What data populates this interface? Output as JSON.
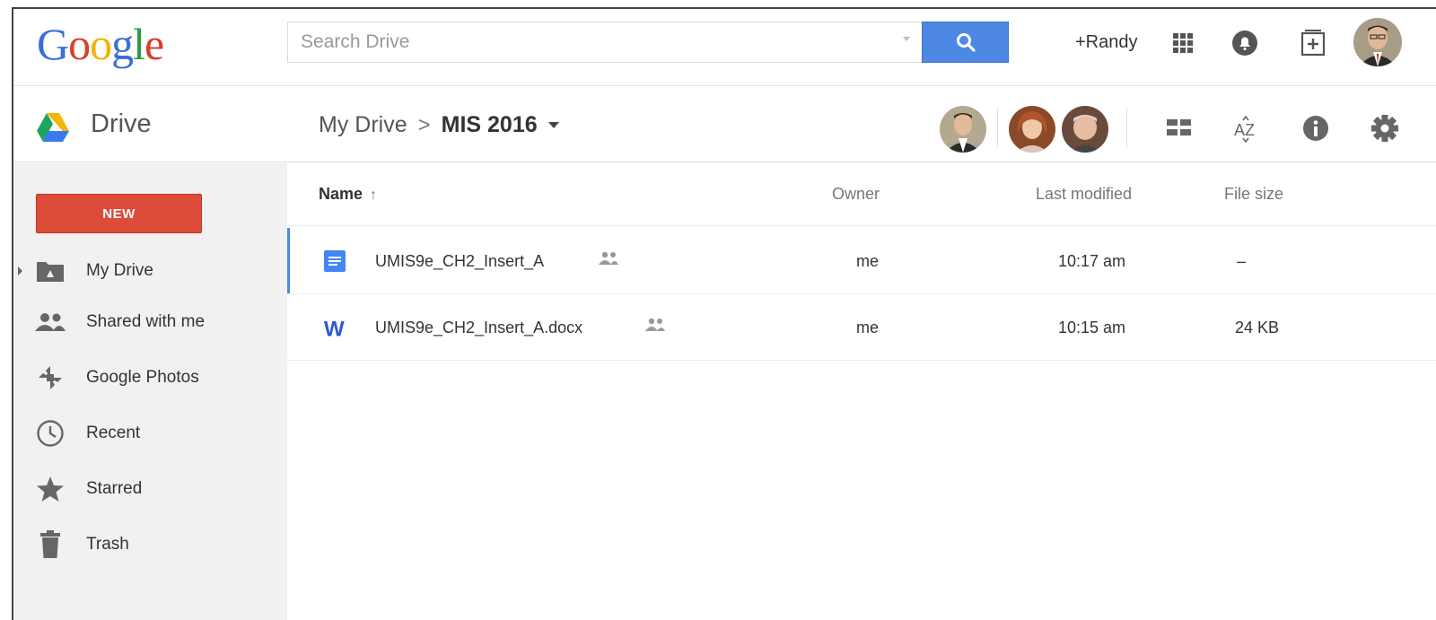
{
  "google_logo": {
    "letters": [
      "G",
      "o",
      "o",
      "g",
      "l",
      "e"
    ],
    "colors": [
      "#3b6ed8",
      "#d6402c",
      "#f0b400",
      "#3b6ed8",
      "#2e9a48",
      "#d6402c"
    ]
  },
  "search": {
    "placeholder": "Search Drive",
    "value": ""
  },
  "header": {
    "user_link": "+Randy",
    "icons": [
      "apps-grid-icon",
      "notifications-icon",
      "share-add-icon"
    ]
  },
  "subbar": {
    "app_name": "Drive",
    "breadcrumb": {
      "root": "My Drive",
      "separator": ">",
      "current": "MIS 2016"
    },
    "icons": [
      "grid-view-icon",
      "sort-az-icon",
      "info-icon",
      "settings-icon"
    ]
  },
  "sidebar": {
    "new_label": "NEW",
    "items": [
      {
        "label": "My Drive",
        "icon": "drive-folder-icon"
      },
      {
        "label": "Shared with me",
        "icon": "people-icon"
      },
      {
        "label": "Google Photos",
        "icon": "photos-pinwheel-icon"
      },
      {
        "label": "Recent",
        "icon": "clock-icon"
      },
      {
        "label": "Starred",
        "icon": "star-icon"
      },
      {
        "label": "Trash",
        "icon": "trash-icon"
      }
    ]
  },
  "list": {
    "columns": {
      "name": "Name",
      "sort_arrow": "↑",
      "owner": "Owner",
      "modified": "Last modified",
      "size": "File size"
    },
    "rows": [
      {
        "name": "UMIS9e_CH2_Insert_A",
        "type": "google-doc",
        "owner": "me",
        "modified": "10:17 am",
        "size": "–"
      },
      {
        "name": "UMIS9e_CH2_Insert_A.docx",
        "type": "word-doc",
        "owner": "me",
        "modified": "10:15 am",
        "size": "24 KB"
      }
    ]
  },
  "colors": {
    "new_button": "#dd4b39",
    "search_button": "#4d88e5",
    "selection_accent": "#4d88e5"
  }
}
